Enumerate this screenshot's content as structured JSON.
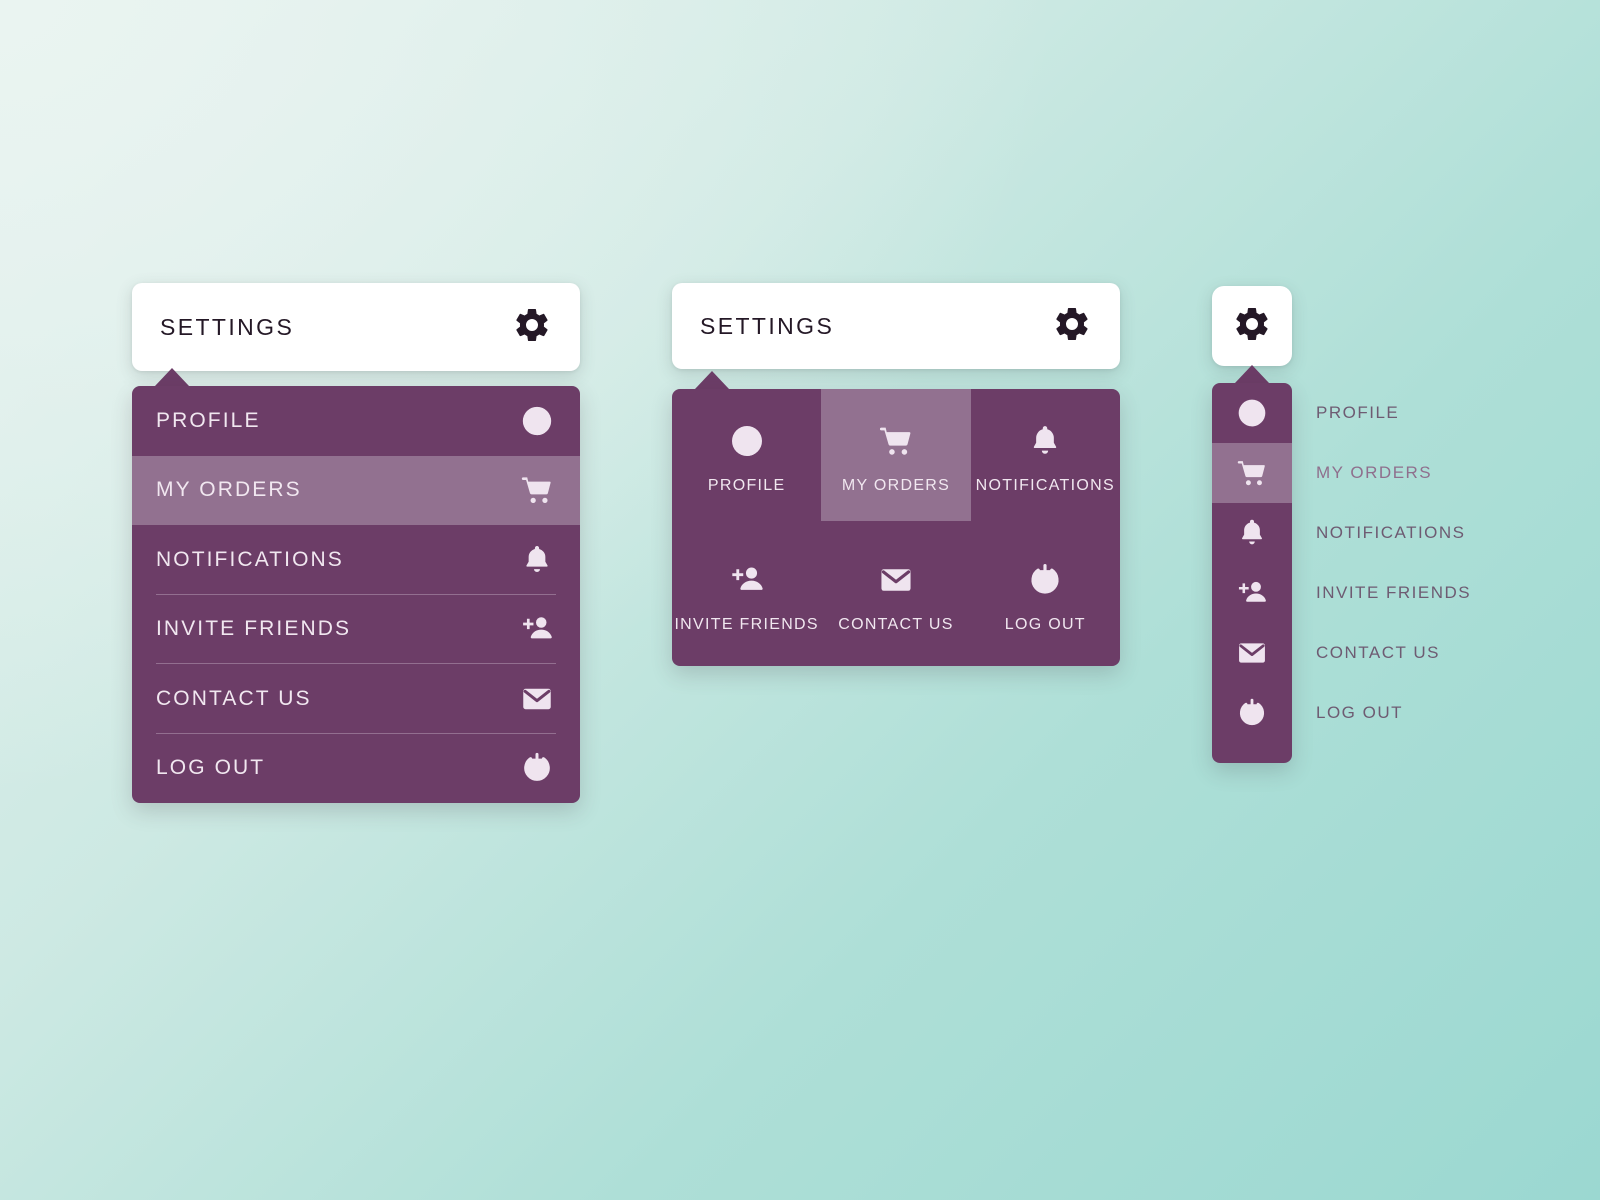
{
  "theme": {
    "panel_purple": "#6C3D67",
    "panel_highlight": "#927190",
    "header_white": "#FFFFFF",
    "icon_light": "#EFE4EF",
    "gear_dark": "#241826",
    "label_muted": "#6E5B72",
    "bg_mint_light": "#E3F1ED",
    "bg_mint_dark": "#9BD8D1"
  },
  "menus": {
    "list_menu": {
      "header_title": "SETTINGS",
      "header_icon": "gear-icon",
      "items": [
        {
          "label": "PROFILE",
          "icon": "person-circle-icon",
          "active": false
        },
        {
          "label": "MY ORDERS",
          "icon": "shopping-cart-icon",
          "active": true
        },
        {
          "label": "NOTIFICATIONS",
          "icon": "bell-icon",
          "active": false
        },
        {
          "label": "INVITE FRIENDS",
          "icon": "person-add-icon",
          "active": false
        },
        {
          "label": "CONTACT US",
          "icon": "envelope-icon",
          "active": false
        },
        {
          "label": "LOG OUT",
          "icon": "power-icon",
          "active": false
        }
      ]
    },
    "grid_menu": {
      "header_title": "SETTINGS",
      "header_icon": "gear-icon",
      "items": [
        {
          "label": "PROFILE",
          "icon": "person-circle-icon",
          "active": false
        },
        {
          "label": "MY ORDERS",
          "icon": "shopping-cart-icon",
          "active": true
        },
        {
          "label": "NOTIFICATIONS",
          "icon": "bell-icon",
          "active": false
        },
        {
          "label": "INVITE FRIENDS",
          "icon": "person-add-icon",
          "active": false
        },
        {
          "label": "CONTACT US",
          "icon": "envelope-icon",
          "active": false
        },
        {
          "label": "LOG OUT",
          "icon": "power-icon",
          "active": false
        }
      ]
    },
    "rail_menu": {
      "header_icon": "gear-icon",
      "items": [
        {
          "label": "PROFILE",
          "icon": "person-circle-icon",
          "active": false
        },
        {
          "label": "MY ORDERS",
          "icon": "shopping-cart-icon",
          "active": true
        },
        {
          "label": "NOTIFICATIONS",
          "icon": "bell-icon",
          "active": false
        },
        {
          "label": "INVITE FRIENDS",
          "icon": "person-add-icon",
          "active": false
        },
        {
          "label": "CONTACT US",
          "icon": "envelope-icon",
          "active": false
        },
        {
          "label": "LOG OUT",
          "icon": "power-icon",
          "active": false
        }
      ]
    }
  }
}
